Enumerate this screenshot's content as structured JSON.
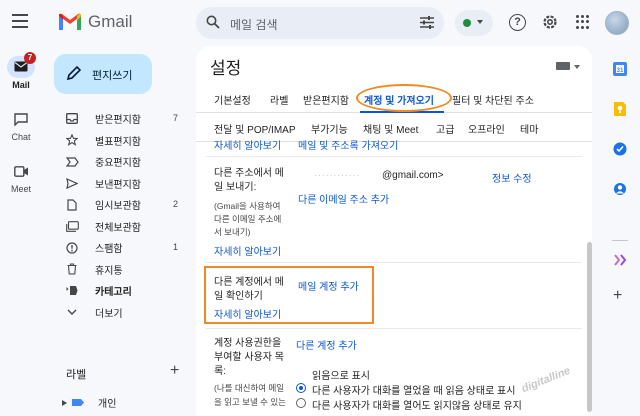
{
  "app": {
    "name": "Gmail"
  },
  "search": {
    "placeholder": "메일 검색"
  },
  "rail": [
    {
      "label": "Mail",
      "badge": "7"
    },
    {
      "label": "Chat"
    },
    {
      "label": "Meet"
    }
  ],
  "compose": {
    "label": "편지쓰기"
  },
  "nav": [
    {
      "label": "받은편지함",
      "count": "7",
      "icon": "inbox-icon"
    },
    {
      "label": "별표편지함",
      "count": "",
      "icon": "star-icon"
    },
    {
      "label": "중요편지함",
      "count": "",
      "icon": "important-icon"
    },
    {
      "label": "보낸편지함",
      "count": "",
      "icon": "send-icon"
    },
    {
      "label": "임시보관함",
      "count": "2",
      "icon": "draft-icon"
    },
    {
      "label": "전체보관함",
      "count": "",
      "icon": "all-mail-icon"
    },
    {
      "label": "스팸함",
      "count": "1",
      "icon": "spam-icon"
    },
    {
      "label": "휴지통",
      "count": "",
      "icon": "trash-icon"
    },
    {
      "label": "카테고리",
      "count": "",
      "icon": "category-icon"
    },
    {
      "label": "더보기",
      "count": "",
      "icon": "chevron-down-icon"
    }
  ],
  "labels": {
    "heading": "라벨",
    "items": [
      {
        "label": "개인"
      }
    ]
  },
  "settings": {
    "title": "설정",
    "tabs_row1": [
      "기본설정",
      "라벨",
      "받은편지함",
      "계정 및 가져오기",
      "필터 및 차단된 주소"
    ],
    "tabs_row2": [
      "전달 및 POP/IMAP",
      "부가기능",
      "채팅 및 Meet",
      "고급",
      "오프라인",
      "테마"
    ],
    "active_tab": "계정 및 가져오기"
  },
  "content": {
    "top_link_learn": "자세히 알아보기",
    "top_link_import": "메일 및 주소록 가져오기",
    "sendas": {
      "label_line1": "다른 주소에서 메",
      "label_line2": "일 보내기:",
      "note_line1": "(Gmail을 사용하여",
      "note_line2": "다른 이메일 주소에",
      "note_line3": "서 보내기)",
      "learn_more": "자세히 알아보기",
      "email_hidden": "············",
      "email_domain": "@gmail.com>",
      "edit_info": "정보 수정",
      "add_other": "다른 이메일 주소 추가"
    },
    "check_mail": {
      "label_line1": "다른 계정에서 메",
      "label_line2": "일 확인하기",
      "learn_more": "자세히 알아보기",
      "add_account": "메일 계정 추가"
    },
    "grant_access": {
      "label_line1": "계정 사용권한을",
      "label_line2": "부여할 사용자 목",
      "label_line3": "록:",
      "note_line1": "(나를 대신하여 메일",
      "note_line2": "을 읽고 보낼 수 있는",
      "add_other_account": "다른 계정 추가",
      "mark_as_read": "읽음으로 표시",
      "option_1": "다른 사용자가 대화를 열었을 때 읽음 상태로 표시",
      "option_2": "다른 사용자가 대화를 열어도 읽지않음 상태로 유지",
      "selected": 1
    }
  },
  "watermark": "digitalline",
  "colors": {
    "accent": "#0b57d0",
    "highlight": "#f08a24",
    "compose_bg": "#c2e7ff"
  }
}
